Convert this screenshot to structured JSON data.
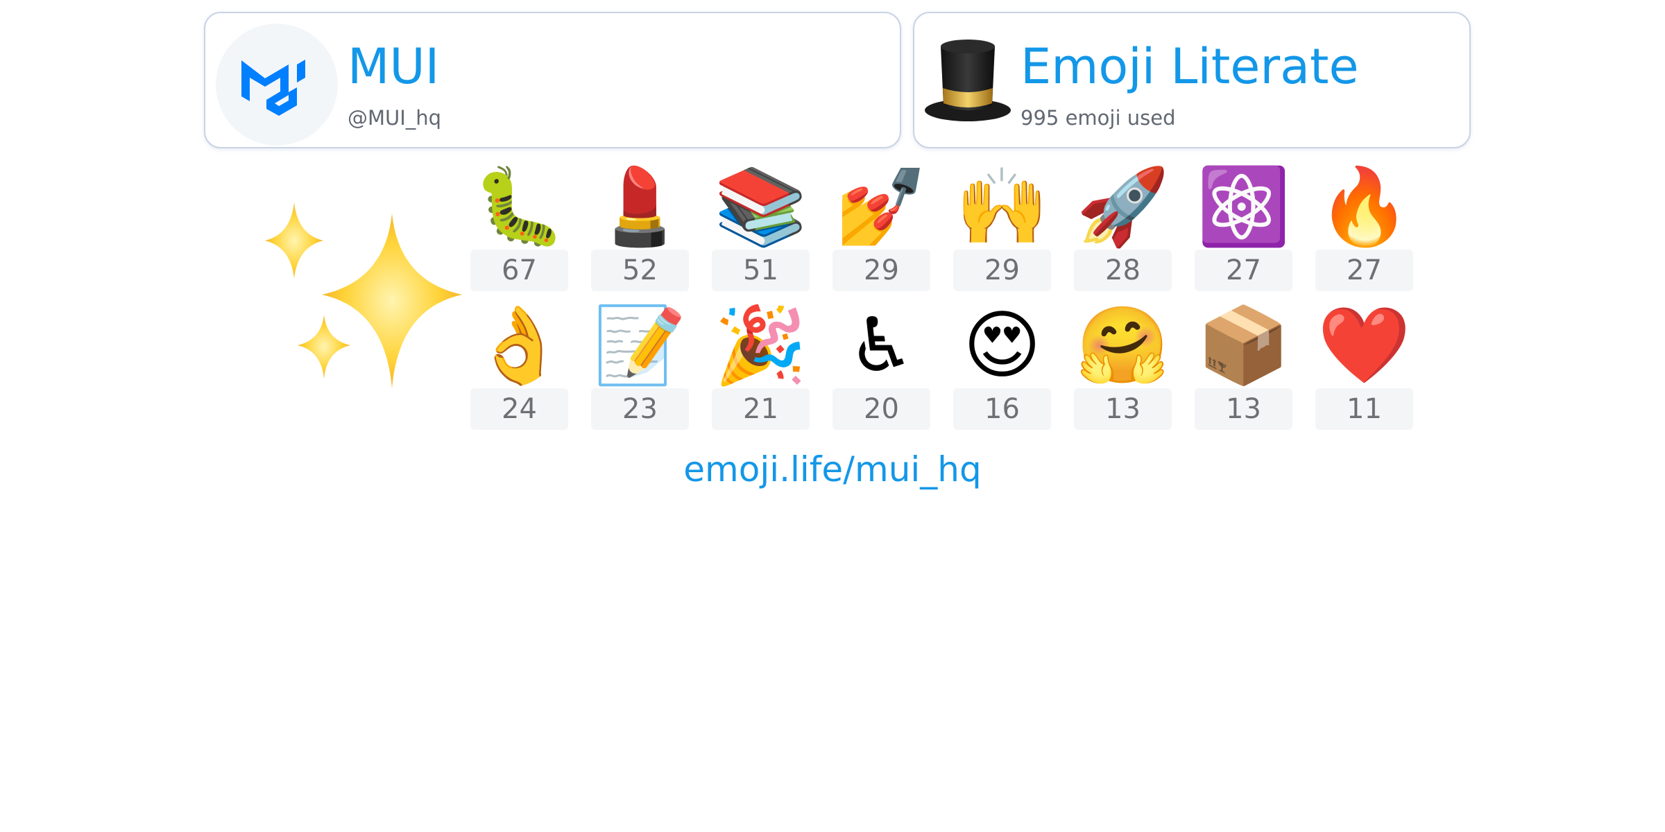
{
  "profile": {
    "name": "MUI",
    "handle": "@MUI_hq",
    "avatar_icon": "mui-logo-icon"
  },
  "badge": {
    "title": "Emoji Literate",
    "subtitle": "995 emoji used",
    "icon": "top-hat-icon"
  },
  "decoration_icon": "sparkles-icon",
  "emoji_stats": [
    {
      "emoji": "🐛",
      "name": "caterpillar-emoji",
      "count": "67"
    },
    {
      "emoji": "💄",
      "name": "lipstick-emoji",
      "count": "52"
    },
    {
      "emoji": "📚",
      "name": "books-emoji",
      "count": "51"
    },
    {
      "emoji": "💅",
      "name": "nail-polish-emoji",
      "count": "29"
    },
    {
      "emoji": "🙌",
      "name": "raising-hands-emoji",
      "count": "29"
    },
    {
      "emoji": "🚀",
      "name": "rocket-emoji",
      "count": "28"
    },
    {
      "emoji": "⚛️",
      "name": "atom-symbol-emoji",
      "count": "27"
    },
    {
      "emoji": "🔥",
      "name": "fire-emoji",
      "count": "27"
    },
    {
      "emoji": "👌",
      "name": "ok-hand-emoji",
      "count": "24"
    },
    {
      "emoji": "📝",
      "name": "memo-emoji",
      "count": "23"
    },
    {
      "emoji": "🎉",
      "name": "party-popper-emoji",
      "count": "21"
    },
    {
      "emoji": "♿",
      "name": "wheelchair-symbol-emoji",
      "count": "20"
    },
    {
      "emoji": "😍",
      "name": "heart-eyes-emoji",
      "count": "16"
    },
    {
      "emoji": "🤗",
      "name": "hugging-face-emoji",
      "count": "13"
    },
    {
      "emoji": "📦",
      "name": "package-emoji",
      "count": "13"
    },
    {
      "emoji": "❤️",
      "name": "red-heart-emoji",
      "count": "11"
    }
  ],
  "footer": {
    "link_text": "emoji.life/mui_hq"
  },
  "colors": {
    "accent": "#1397e8",
    "mui_blue": "#007fff",
    "card_border": "#c9d3e6",
    "count_bg": "#f4f5f7",
    "count_text": "#6d6f73"
  }
}
